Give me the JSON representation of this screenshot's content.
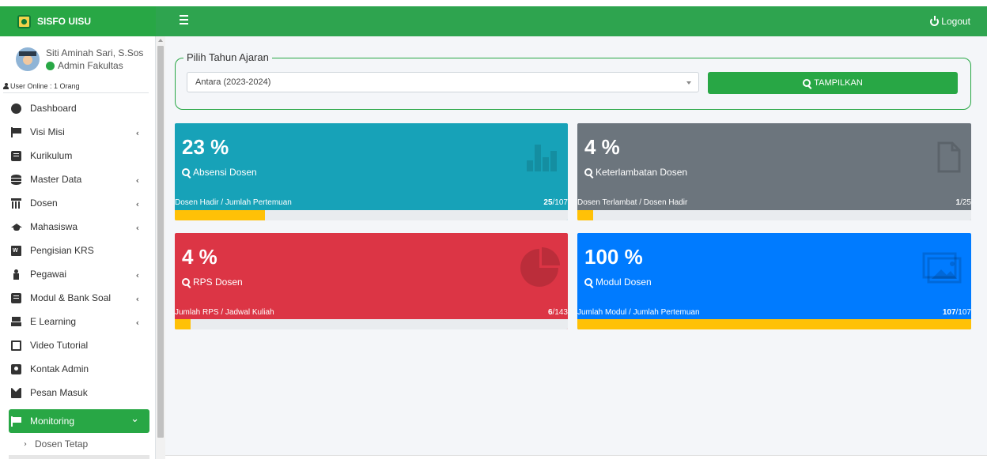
{
  "header": {
    "brand": "SISFO UISU",
    "logout": "Logout"
  },
  "user": {
    "name": "Siti Aminah Sari, S.Sos",
    "role": "Admin Fakultas",
    "online": "User Online : 1 Orang"
  },
  "sidebar": {
    "items": [
      {
        "label": "Dashboard",
        "icon": "dashboard-icon"
      },
      {
        "label": "Visi Misi",
        "icon": "flag-icon",
        "chevron": "‹"
      },
      {
        "label": "Kurikulum",
        "icon": "book-icon"
      },
      {
        "label": "Master Data",
        "icon": "database-icon",
        "chevron": "‹"
      },
      {
        "label": "Dosen",
        "icon": "university-icon",
        "chevron": "‹"
      },
      {
        "label": "Mahasiswa",
        "icon": "graduation-cap-icon",
        "chevron": "‹"
      },
      {
        "label": "Pengisian KRS",
        "icon": "word-file-icon"
      },
      {
        "label": "Pegawai",
        "icon": "person-icon",
        "chevron": "‹"
      },
      {
        "label": "Modul & Bank Soal",
        "icon": "book-icon",
        "chevron": "‹"
      },
      {
        "label": "E Learning",
        "icon": "couch-icon",
        "chevron": "‹"
      },
      {
        "label": "Video Tutorial",
        "icon": "monitor-icon"
      },
      {
        "label": "Kontak Admin",
        "icon": "contact-icon"
      },
      {
        "label": "Pesan Masuk",
        "icon": "envelope-icon"
      }
    ],
    "active": {
      "label": "Monitoring",
      "icon": "flag-icon",
      "chevron": "⌄"
    },
    "sub": {
      "label": "Dosen Tetap",
      "arrow": "›"
    }
  },
  "filter": {
    "legend": "Pilih Tahun Ajaran",
    "selected": "Antara (2023-2024)",
    "button": "TAMPILKAN"
  },
  "cards": [
    {
      "value": "23 %",
      "label": "Absensi Dosen",
      "footer": "Dosen Hadir / Jumlah Pertemuan",
      "num": "25",
      "den": "/107",
      "progress": 0.23,
      "color": "#17a2b8",
      "icon": "bar-chart-icon"
    },
    {
      "value": "4 %",
      "label": "Keterlambatan Dosen",
      "footer": "Dosen Terlambat / Dosen Hadir",
      "num": "1",
      "den": "/25",
      "progress": 0.04,
      "color": "#6c757d",
      "icon": "file-icon"
    },
    {
      "value": "4 %",
      "label": "RPS Dosen",
      "footer": "Jumlah RPS / Jadwal Kuliah",
      "num": "6",
      "den": "/143",
      "progress": 0.04,
      "color": "#dc3545",
      "icon": "pie-chart-icon"
    },
    {
      "value": "100 %",
      "label": "Modul Dosen",
      "footer": "Jumlah Modul / Jumlah Pertemuan",
      "num": "107",
      "den": "/107",
      "progress": 1.0,
      "color": "#007bff",
      "icon": "images-icon"
    }
  ],
  "colors": {
    "brand": "#28a745",
    "progress": "#ffc107"
  }
}
